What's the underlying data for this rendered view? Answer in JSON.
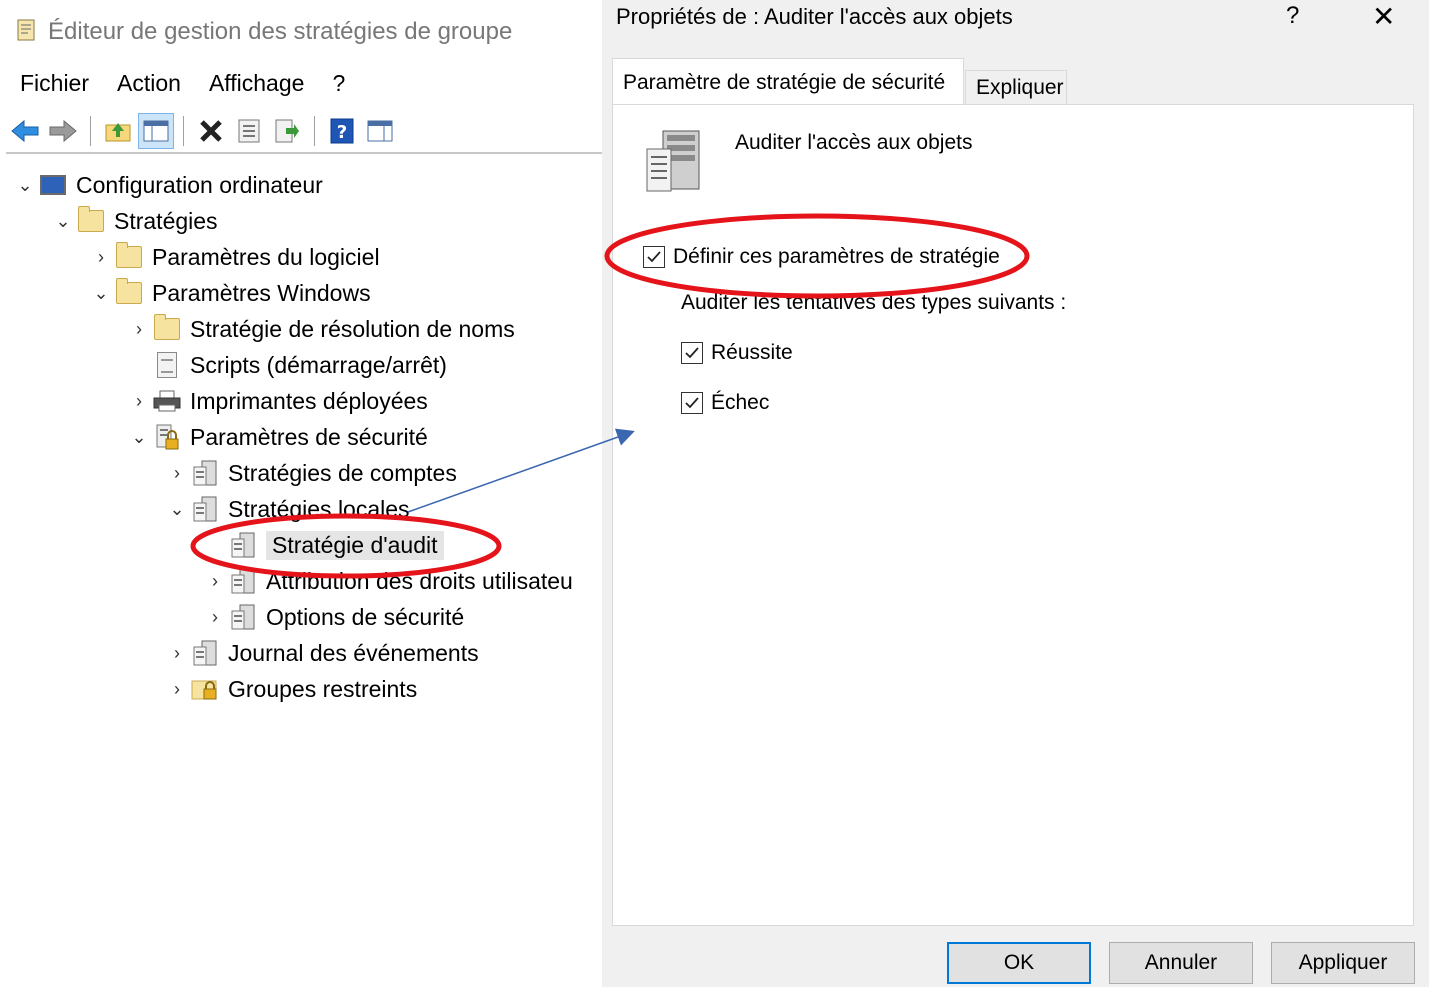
{
  "editor": {
    "title": "Éditeur de gestion des stratégies de groupe",
    "menu": [
      "Fichier",
      "Action",
      "Affichage",
      "?"
    ],
    "toolbar_icons": [
      "back-icon",
      "forward-icon",
      "up-folder-icon",
      "show-hide-tree-icon",
      "delete-icon",
      "properties-icon",
      "export-list-icon",
      "help-icon",
      "show-hide-action-pane-icon"
    ],
    "tree": [
      {
        "label": "Configuration ordinateur",
        "icon": "computer-icon",
        "chevron": "⌄"
      },
      {
        "label": "Stratégies",
        "icon": "folder-icon",
        "chevron": "⌄"
      },
      {
        "label": "Paramètres du logiciel",
        "icon": "folder-icon",
        "chevron": "›"
      },
      {
        "label": "Paramètres Windows",
        "icon": "folder-icon",
        "chevron": "⌄"
      },
      {
        "label": "Stratégie de résolution de noms",
        "icon": "folder-icon",
        "chevron": "›"
      },
      {
        "label": "Scripts (démarrage/arrêt)",
        "icon": "script-icon",
        "chevron": ""
      },
      {
        "label": "Imprimantes déployées",
        "icon": "printer-icon",
        "chevron": "›"
      },
      {
        "label": "Paramètres de sécurité",
        "icon": "security-icon",
        "chevron": "⌄"
      },
      {
        "label": "Stratégies de comptes",
        "icon": "policy-icon",
        "chevron": "›"
      },
      {
        "label": "Stratégies locales",
        "icon": "policy-icon",
        "chevron": "⌄"
      },
      {
        "label": "Stratégie d'audit",
        "icon": "policy-icon",
        "chevron": ""
      },
      {
        "label": "Attribution des droits utilisateu",
        "icon": "policy-icon",
        "chevron": "›"
      },
      {
        "label": "Options de sécurité",
        "icon": "policy-icon",
        "chevron": "›"
      },
      {
        "label": "Journal des événements",
        "icon": "policy-icon",
        "chevron": "›"
      },
      {
        "label": "Groupes restreints",
        "icon": "locked-folder-icon",
        "chevron": "›"
      }
    ]
  },
  "dialog": {
    "title": "Propriétés de : Auditer l'accès aux objets",
    "help": "?",
    "close": "✕",
    "tabs": [
      "Paramètre de stratégie de sécurité",
      "Expliquer"
    ],
    "policy_name": "Auditer l'accès aux objets",
    "define_label": "Définir ces paramètres de stratégie",
    "define_checked": true,
    "audit_label": "Auditer les tentatives des types suivants :",
    "success_label": "Réussite",
    "success_checked": true,
    "failure_label": "Échec",
    "failure_checked": true,
    "buttons": {
      "ok": "OK",
      "cancel": "Annuler",
      "apply": "Appliquer"
    }
  },
  "colors": {
    "annotation_red": "#e5141b",
    "annotation_arrow": "#3b66b0",
    "accent": "#0078d7"
  }
}
